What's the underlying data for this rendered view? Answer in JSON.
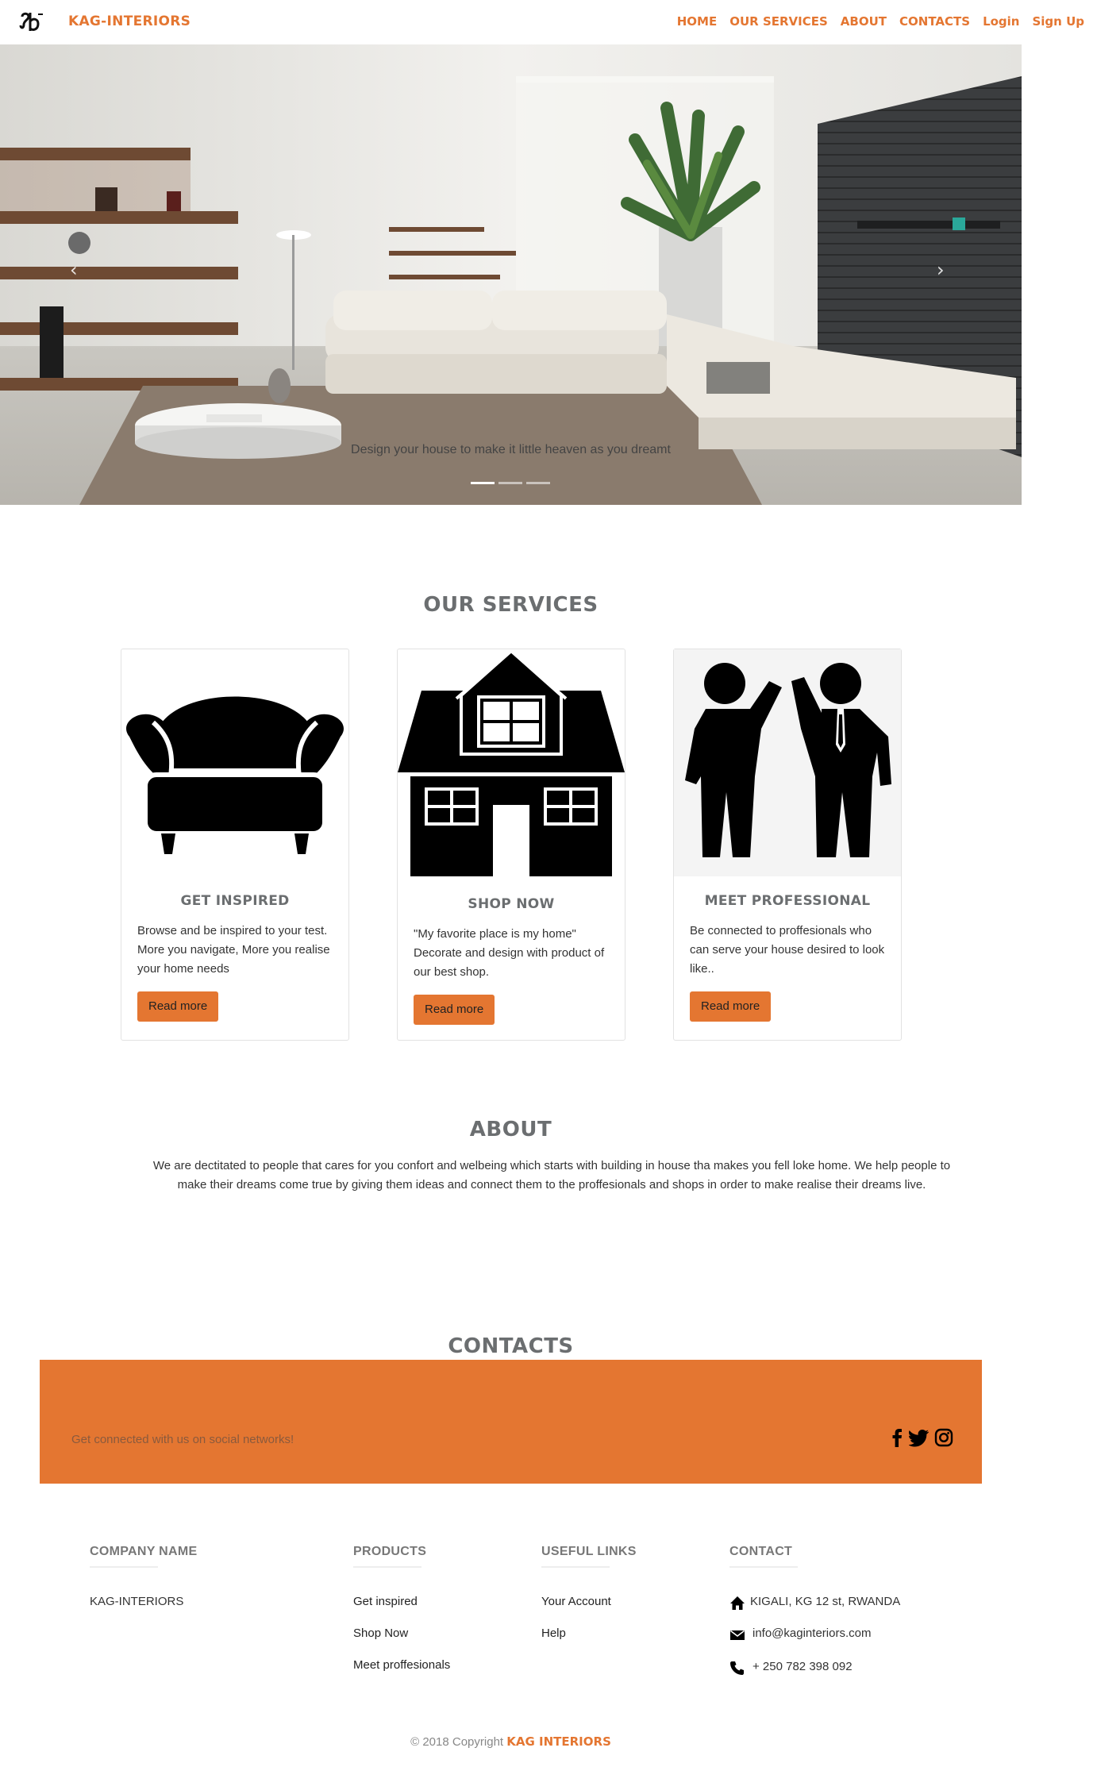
{
  "navbar": {
    "logo_text": "ꓘ",
    "brand": "KAG-INTERIORS",
    "links": [
      "HOME",
      "OUR SERVICES",
      "ABOUT",
      "CONTACTS",
      "Login",
      "Sign Up"
    ]
  },
  "hero": {
    "caption": "Design your house to make it little heaven as you dreamt",
    "prev_icon": "chevron-left-icon",
    "next_icon": "chevron-right-icon",
    "slide_count": 3,
    "active_slide": 1
  },
  "services": {
    "title": "OUR SERVICES",
    "cards": [
      {
        "title": "GET INSPIRED",
        "text": "Browse and be inspired to your test. More you navigate, More you realise your home needs",
        "button": "Read more",
        "icon": "armchair-icon"
      },
      {
        "title": "SHOP NOW",
        "text": "\"My favorite place is my home\" Decorate and design with product of our best shop.",
        "button": "Read more",
        "icon": "house-icon"
      },
      {
        "title": "MEET PROFESSIONAL",
        "text": "Be connected to proffesionals who can serve your house desired to look like..",
        "button": "Read more",
        "icon": "handshake-people-icon"
      }
    ]
  },
  "about": {
    "title": "ABOUT",
    "text": "We are dectitated to people that cares for you confort and welbeing which starts with building in house tha makes you fell loke home. We help people to make their dreams come true by giving them ideas and connect them to the proffesionals and shops in order to make realise their dreams live."
  },
  "contacts": {
    "title": "CONTACTS",
    "band_text": "Get connected with us on social networks!",
    "social": [
      "facebook-icon",
      "twitter-icon",
      "instagram-icon"
    ]
  },
  "footer": {
    "company": {
      "heading": "COMPANY NAME",
      "name": "KAG-INTERIORS"
    },
    "products": {
      "heading": "PRODUCTS",
      "links": [
        "Get inspired",
        "Shop Now",
        "Meet proffesionals"
      ]
    },
    "useful": {
      "heading": "USEFUL LINKS",
      "links": [
        "Your Account",
        "Help"
      ]
    },
    "contact": {
      "heading": "CONTACT",
      "address": "KIGALI, KG 12 st, RWANDA",
      "email": "info@kaginteriors.com",
      "phone": "+ 250 782 398 092"
    },
    "copyright_prefix": "© 2018 Copyright",
    "copyright_brand": "KAG INTERIORS"
  },
  "colors": {
    "accent": "#e47631",
    "heading_gray": "#6b6e70"
  }
}
